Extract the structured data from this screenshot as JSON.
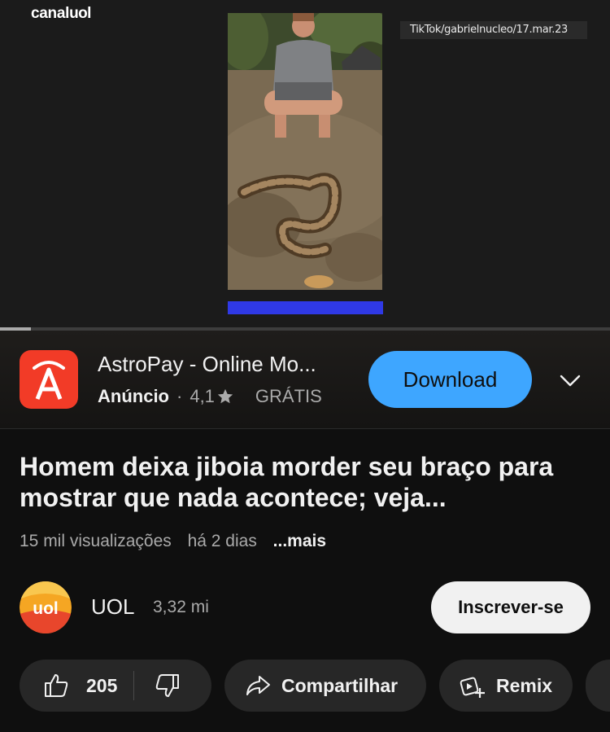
{
  "video": {
    "brand_part1": "canal",
    "brand_part2": "uol",
    "source_credit": "TikTok/gabrielnucleo/17.mar.23",
    "progress_fraction": 0.05
  },
  "ad": {
    "app_name": "AstroPay - Online Mo...",
    "label": "Anúncio",
    "separator": "·",
    "rating": "4,1",
    "price": "GRÁTIS",
    "cta": "Download",
    "icon_color": "#f23b27"
  },
  "video_info": {
    "title": "Homem deixa jiboia morder seu braço para mostrar que nada acontece; veja...",
    "views": "15 mil visualizações",
    "age": "há 2 dias",
    "more": "...mais"
  },
  "channel": {
    "name": "UOL",
    "subscribers": "3,32 mi",
    "subscribe_label": "Inscrever-se"
  },
  "actions": {
    "like_count": "205",
    "share_label": "Compartilhar",
    "remix_label": "Remix"
  },
  "colors": {
    "background": "#0f0f0f",
    "accent_blue": "#3ea6ff",
    "pill": "#272727"
  }
}
